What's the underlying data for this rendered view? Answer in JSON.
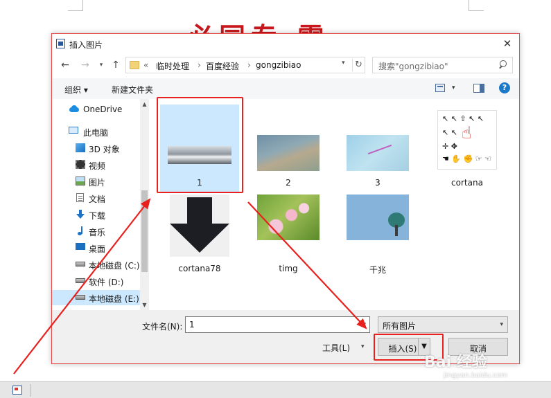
{
  "document": {
    "heading": "必同专 雷"
  },
  "dialog": {
    "title": "插入图片",
    "close_glyph": "✕",
    "address": {
      "overflow": "«",
      "segments": [
        "临时处理",
        "百度经验",
        "gongzibiao"
      ],
      "separator": "›"
    },
    "search": {
      "placeholder": "搜索\"gongzibiao\""
    },
    "toolbar": {
      "organize": "组织 ▾",
      "new_folder": "新建文件夹",
      "help": "?"
    },
    "nav": {
      "items": [
        {
          "label": "OneDrive"
        },
        {
          "label": "此电脑"
        },
        {
          "label": "3D 对象"
        },
        {
          "label": "视频"
        },
        {
          "label": "图片"
        },
        {
          "label": "文档"
        },
        {
          "label": "下载"
        },
        {
          "label": "音乐"
        },
        {
          "label": "桌面"
        },
        {
          "label": "本地磁盘 (C:)"
        },
        {
          "label": "软件 (D:)"
        },
        {
          "label": "本地磁盘 (E:)"
        }
      ]
    },
    "files": [
      {
        "name": "1",
        "selected": true
      },
      {
        "name": "2"
      },
      {
        "name": "3"
      },
      {
        "name": "cortana"
      },
      {
        "name": "cortana78"
      },
      {
        "name": "timg"
      },
      {
        "name": "千兆"
      }
    ],
    "filename": {
      "label": "文件名(N):",
      "value": "1"
    },
    "filetype": {
      "value": "所有图片"
    },
    "tools": {
      "label": "工具(L)"
    },
    "buttons": {
      "insert": "插入(S)",
      "cancel": "取消"
    }
  },
  "watermark": {
    "brand": "Bai 经验",
    "url": "jingyan.baidu.com"
  },
  "colors": {
    "annotation": "#e8201e",
    "selection": "#cce8ff",
    "heading": "#c8181e"
  }
}
